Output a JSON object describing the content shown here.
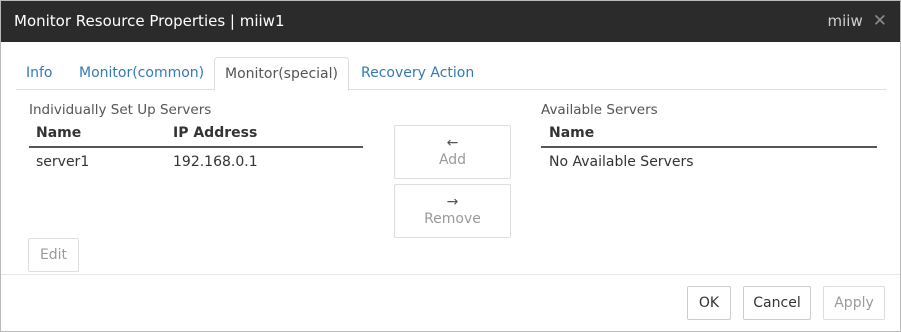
{
  "window": {
    "title": "Monitor Resource Properties | miiw1",
    "user": "miiw",
    "close_glyph": "✕"
  },
  "tabs": [
    {
      "label": "Info"
    },
    {
      "label": "Monitor(common)"
    },
    {
      "label": "Monitor(special)"
    },
    {
      "label": "Recovery Action"
    }
  ],
  "active_tab": "Monitor(special)",
  "left_panel": {
    "title": "Individually Set Up Servers",
    "columns": [
      "Name",
      "IP Address"
    ],
    "rows": [
      {
        "name": "server1",
        "ip": "192.168.0.1"
      }
    ],
    "edit_label": "Edit"
  },
  "middle": {
    "add_label": "Add",
    "add_arrow": "←",
    "remove_label": "Remove",
    "remove_arrow": "→"
  },
  "right_panel": {
    "title": "Available Servers",
    "columns": [
      "Name"
    ],
    "empty_text": "No Available Servers"
  },
  "footer": {
    "ok_label": "OK",
    "cancel_label": "Cancel",
    "apply_label": "Apply"
  },
  "colors": {
    "titlebar": "#2b2b2b",
    "link_tab": "#337ab7",
    "disabled_text": "#9a9a9a"
  }
}
